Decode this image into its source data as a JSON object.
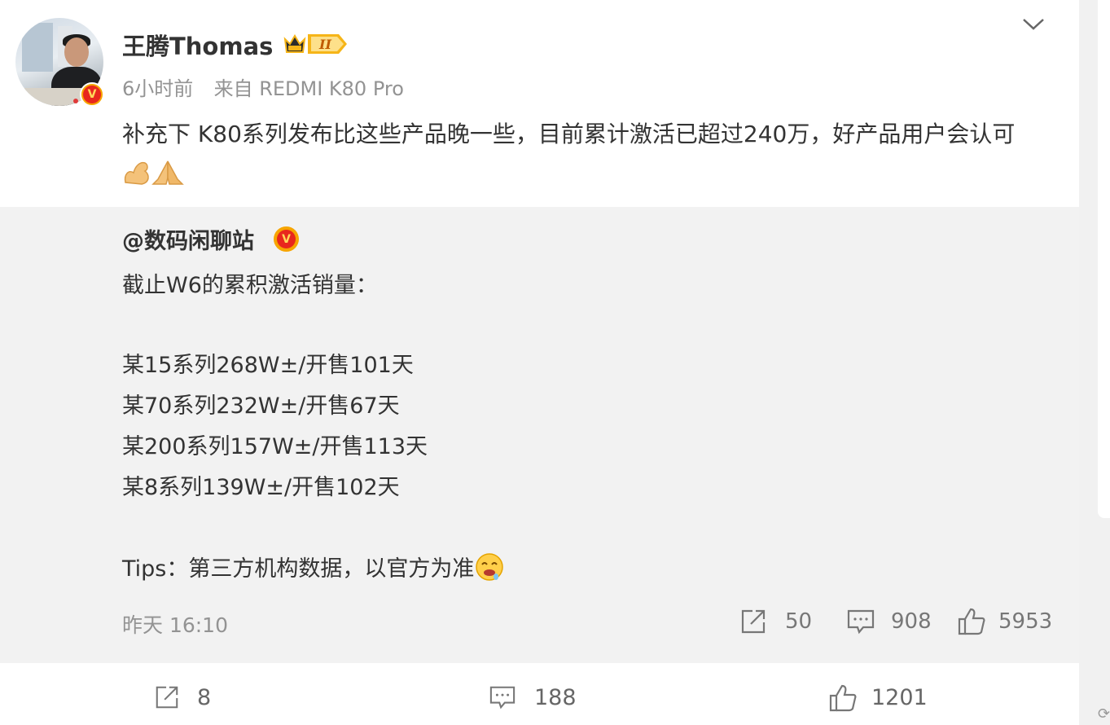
{
  "post": {
    "username": "王腾Thomas",
    "time": "6小时前",
    "source": "来自 REDMI K80 Pro",
    "content": "补充下 K80系列发布比这些产品晚一些，目前累计激活已超过240万，好产品用户会认可",
    "content_emojis": [
      "flexed-biceps-emoji",
      "folded-hands-emoji"
    ]
  },
  "repost": {
    "author": "@数码闲聊站",
    "lines": [
      "截止W6的累积激活销量：",
      "某15系列268W±/开售101天",
      "某70系列232W±/开售67天",
      "某200系列157W±/开售113天",
      "某8系列139W±/开售102天",
      "Tips：第三方机构数据，以官方为准"
    ],
    "time": "昨天 16:10",
    "reposts": "50",
    "comments": "908",
    "likes": "5953"
  },
  "actions": {
    "reposts": "8",
    "comments": "188",
    "likes": "1201"
  },
  "icons": {
    "more": "chevron-down-icon",
    "repost": "share-icon",
    "comment": "comment-icon",
    "like": "thumbs-up-icon",
    "verified": "verified-v-icon",
    "vip": "vip-crown-badge-icon"
  },
  "colors": {
    "text": "#333333",
    "meta": "#939393",
    "repost_bg": "#f2f2f2",
    "verified_red": "#e8271d",
    "verified_gold": "#f7a500"
  }
}
